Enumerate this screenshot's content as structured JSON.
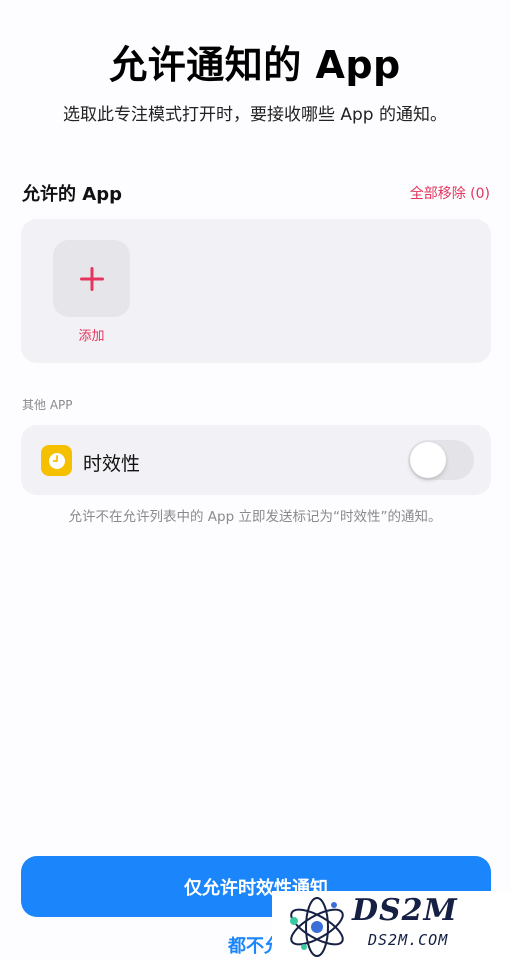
{
  "header": {
    "title": "允许通知的 App",
    "subtitle": "选取此专注模式打开时，要接收哪些 App 的通知。"
  },
  "allowed_apps": {
    "section_title": "允许的 App",
    "remove_all_label": "全部移除 (0)",
    "add_label": "添加",
    "add_icon": "plus-icon"
  },
  "other_apps": {
    "section_label": "其他 APP",
    "time_sensitive": {
      "label": "时效性",
      "icon": "clock-icon",
      "enabled": false
    },
    "footnote": "允许不在允许列表中的 App 立即发送标记为“时效性”的通知。"
  },
  "actions": {
    "primary_label": "仅允许时效性通知",
    "secondary_label": "都不允"
  },
  "watermark": {
    "brand": "DS2M",
    "domain": "DS2M.COM"
  },
  "colors": {
    "accent_blue": "#1b86fb",
    "destructive_red": "#e5355e",
    "card_background": "#f2f1f6",
    "time_sensitive_yellow": "#f5c000"
  }
}
